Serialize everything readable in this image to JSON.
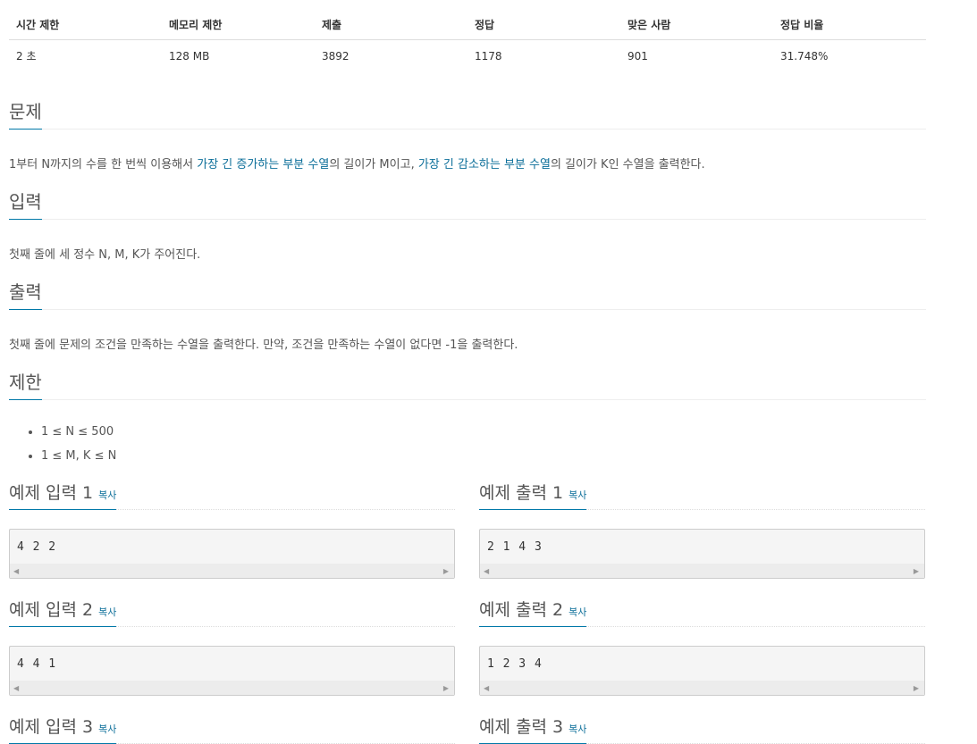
{
  "stats": {
    "headers": [
      "시간 제한",
      "메모리 제한",
      "제출",
      "정답",
      "맞은 사람",
      "정답 비율"
    ],
    "values": [
      "2 초",
      "128 MB",
      "3892",
      "1178",
      "901",
      "31.748%"
    ]
  },
  "problem": {
    "title": "문제",
    "text_1": "1부터 N까지의 수를 한 번씩 이용해서 ",
    "link_1": "가장 긴 증가하는 부분 수열",
    "text_2": "의 길이가 M이고, ",
    "link_2": "가장 긴 감소하는 부분 수열",
    "text_3": "의 길이가 K인 수열을 출력한다."
  },
  "input": {
    "title": "입력",
    "text": "첫째 줄에 세 정수 N, M, K가 주어진다."
  },
  "output": {
    "title": "출력",
    "text": "첫째 줄에 문제의 조건을 만족하는 수열을 출력한다. 만약, 조건을 만족하는 수열이 없다면 -1을 출력한다."
  },
  "limits": {
    "title": "제한",
    "items": [
      "1 ≤ N ≤ 500",
      "1 ≤ M, K ≤ N"
    ]
  },
  "samples": {
    "copy_label": "복사",
    "in1_title": "예제 입력 1",
    "out1_title": "예제 출력 1",
    "in1": "4 2 2",
    "out1": "2 1 4 3",
    "in2_title": "예제 입력 2",
    "out2_title": "예제 출력 2",
    "in2": "4 4 1",
    "out2": "1 2 3 4",
    "in3_title": "예제 입력 3",
    "out3_title": "예제 출력 3"
  },
  "icons": {
    "scroll_left": "scroll-left-arrow",
    "scroll_right": "scroll-right-arrow"
  },
  "colors": {
    "accent": "#0078a8",
    "link": "#0b6e99"
  }
}
